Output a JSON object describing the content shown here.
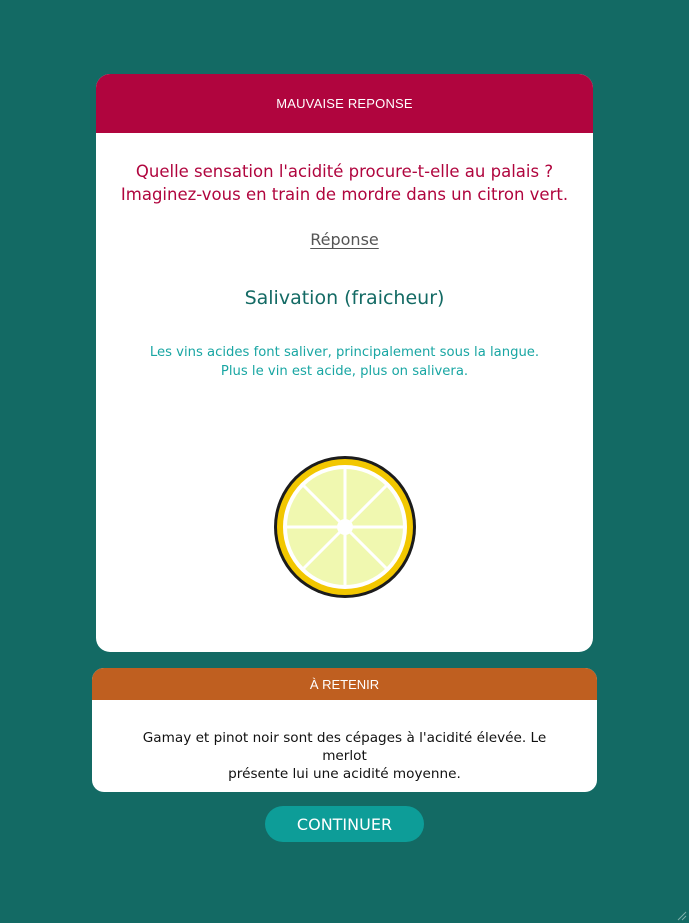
{
  "feedback": {
    "header": "MAUVAISE REPONSE",
    "question_line1": "Quelle sensation l'acidité procure-t-elle au palais ?",
    "question_line2": "Imaginez-vous en train de mordre dans un citron vert.",
    "answer_label": "Réponse",
    "answer": "Salivation (fraicheur)",
    "explanation_line1": "Les vins acides font saliver, principalement sous la langue.",
    "explanation_line2": "Plus le vin est acide, plus on salivera.",
    "illustration_icon": "lemon-slice-icon"
  },
  "remember": {
    "header": "À RETENIR",
    "text_line1": "Gamay et pinot noir sont des cépages à l'acidité élevée. Le merlot",
    "text_line2": "présente lui une acidité moyenne."
  },
  "continue_label": "CONTINUER",
  "colors": {
    "background": "#136a64",
    "wrong_answer": "#b0053e",
    "answer": "#136a64",
    "explanation": "#19a6a3",
    "remember_header": "#bf5f20",
    "continue_button": "#0d9d98"
  }
}
